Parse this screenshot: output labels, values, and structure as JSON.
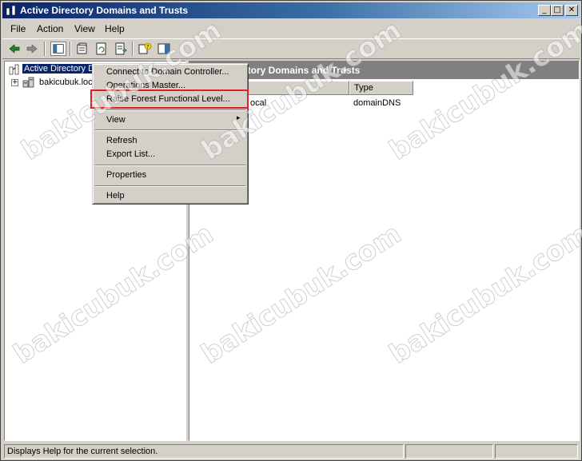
{
  "window": {
    "title": "Active Directory Domains and Trusts",
    "controls": {
      "minimize": "_",
      "maximize": "□",
      "close": "✕"
    }
  },
  "menu": [
    "File",
    "Action",
    "View",
    "Help"
  ],
  "tree": {
    "root": "Active Directory D",
    "child": "bakicubuk.loc"
  },
  "right_pane": {
    "header": "ctory Domains and Trusts",
    "columns": [
      "",
      "Type"
    ],
    "rows": [
      {
        "name": "ocal",
        "type": "domainDNS"
      }
    ]
  },
  "context_menu": {
    "items": [
      "Connect to Domain Controller...",
      "Operations Master...",
      "Raise Forest Functional Level...",
      "View",
      "Refresh",
      "Export List...",
      "Properties",
      "Help"
    ],
    "submenu_arrow": "▸"
  },
  "status": {
    "text": "Displays Help for the current selection."
  },
  "watermark": "bakicubuk.com",
  "colors": {
    "title_start": "#0a246a",
    "title_end": "#a6caf0",
    "face": "#d4d0c8",
    "highlight_red": "#e02020"
  }
}
